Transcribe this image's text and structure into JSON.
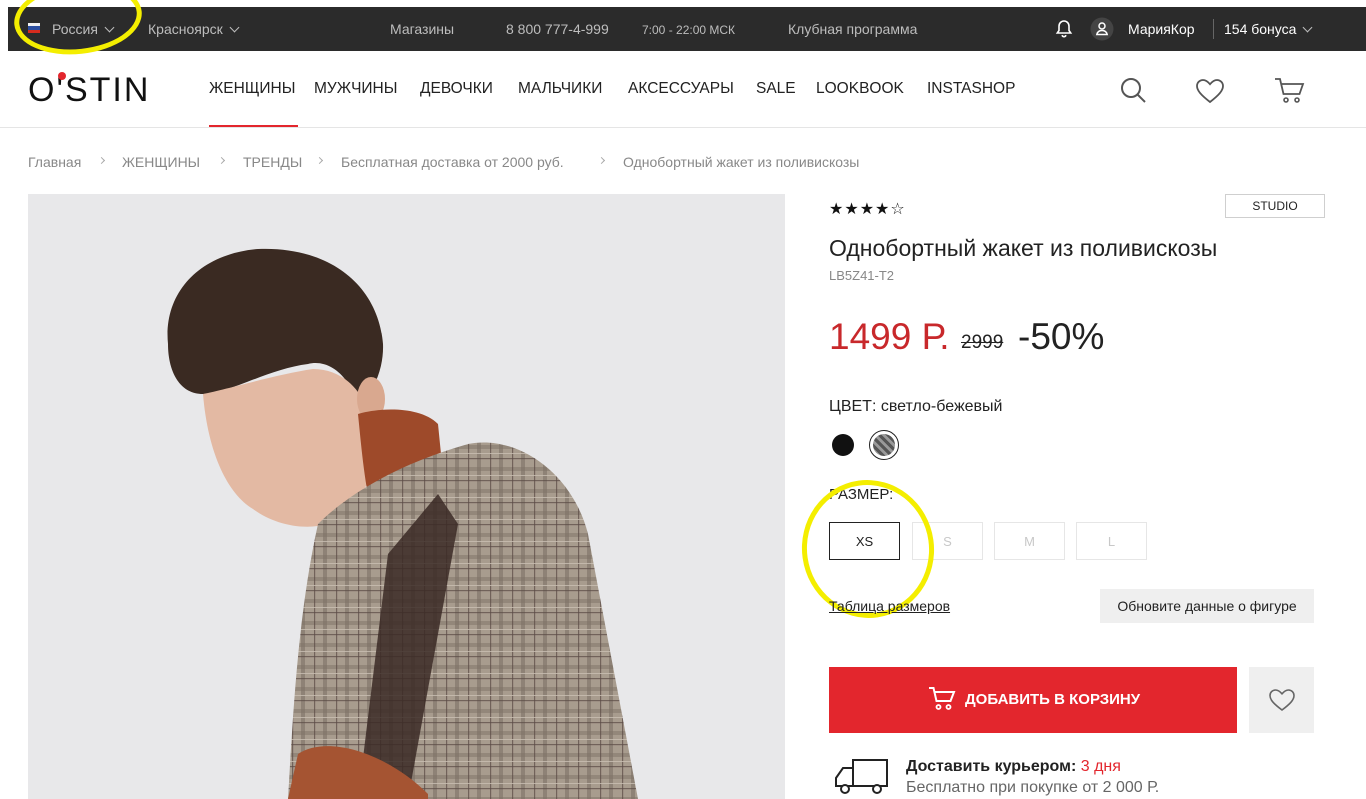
{
  "topbar": {
    "country": "Россия",
    "city": "Красноярск",
    "stores": "Магазины",
    "phone": "8 800 777-4-999",
    "hours": "7:00 - 22:00 МСК",
    "club": "Клубная программа",
    "user": "МарияКор",
    "bonus": "154 бонуса"
  },
  "header": {
    "logo": "O'STIN",
    "nav": [
      "ЖЕНЩИНЫ",
      "МУЖЧИНЫ",
      "ДЕВОЧКИ",
      "МАЛЬЧИКИ",
      "АКСЕССУАРЫ",
      "SALE",
      "LOOKBOOK",
      "INSTASHOP"
    ]
  },
  "breadcrumbs": [
    "Главная",
    "ЖЕНЩИНЫ",
    "ТРЕНДЫ",
    "Бесплатная доставка от 2000 руб.",
    "Однобортный жакет из поливискозы"
  ],
  "product": {
    "rating_stars": "★★★★☆",
    "rating": 4.5,
    "badge": "STUDIO",
    "title": "Однобортный жакет из поливискозы",
    "sku": "LB5Z41-T2",
    "price": "1499 Р.",
    "old_price": "2999",
    "discount": "-50%",
    "color_label": "ЦВЕТ: светло-бежевый",
    "colors": [
      {
        "name": "black",
        "hex": "#111111"
      },
      {
        "name": "plaid",
        "hex": "#7a7a7a"
      }
    ],
    "size_label": "РАЗМЕР:",
    "sizes": [
      "XS",
      "S",
      "M",
      "L"
    ],
    "selected_size": "XS",
    "size_table_link": "Таблица размеров",
    "update_figure_button": "Обновите данные о фигуре",
    "add_to_cart": "ДОБАВИТЬ В КОРЗИНУ",
    "delivery_title": "Доставить курьером:",
    "delivery_days": "3 дня",
    "delivery_sub": "Бесплатно при покупке от 2 000 Р."
  },
  "colors": {
    "accent": "#e3262d",
    "price": "#c8282b",
    "topbar_bg": "#2b2b2b",
    "highlight": "#f4ee00"
  }
}
